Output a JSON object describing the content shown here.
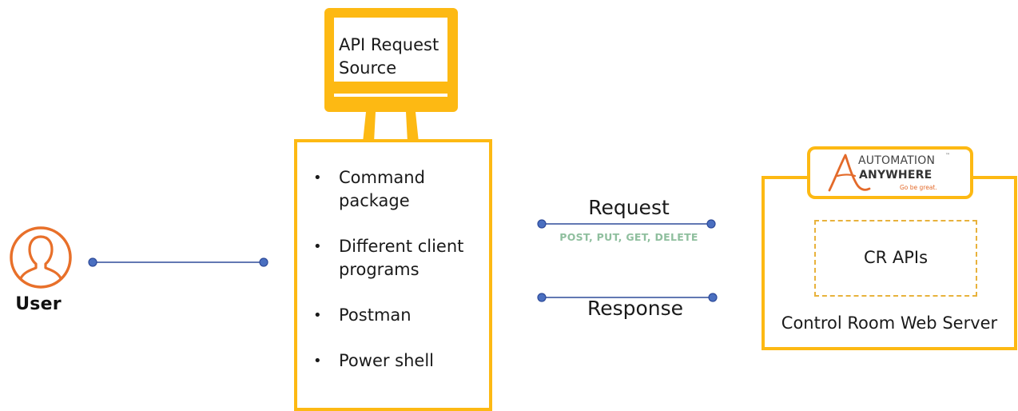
{
  "user": {
    "label": "User",
    "icon": "user-icon"
  },
  "api_source": {
    "title": "API Request Source",
    "icon": "monitor-icon",
    "clients": [
      {
        "bullet": "•",
        "label": "Command package"
      },
      {
        "bullet": "•",
        "label": "Different client programs"
      },
      {
        "bullet": "•",
        "label": "Postman"
      },
      {
        "bullet": "•",
        "label": "Power shell"
      }
    ]
  },
  "flows": {
    "request_label": "Request",
    "methods_label": "POST, PUT, GET, DELETE",
    "response_label": "Response"
  },
  "control_room": {
    "logo_line1": "AUTOMATION",
    "logo_tm": "™",
    "logo_line2": "ANYWHERE",
    "logo_tagline": "Go be great.",
    "apis_label": "CR APIs",
    "server_label": "Control Room Web Server"
  },
  "colors": {
    "accent_yellow": "#FDB913",
    "user_orange": "#E8702A",
    "connector_blue": "#2E4B9A",
    "methods_green": "#8FBF9E",
    "dashed_gold": "#E8B23C"
  }
}
